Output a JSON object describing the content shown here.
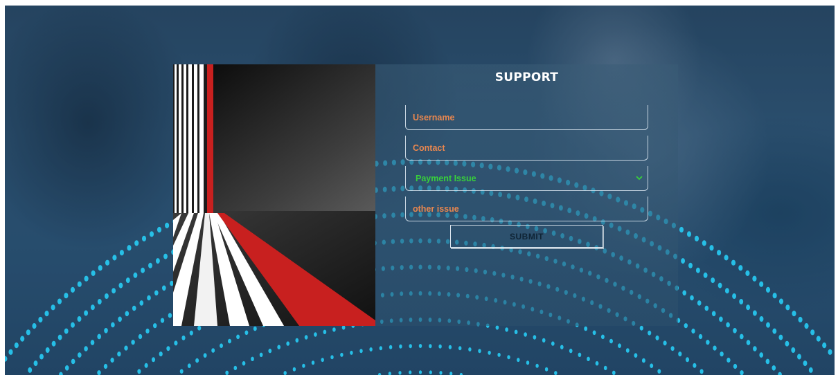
{
  "form": {
    "title": "SUPPORT",
    "username_placeholder": "Username",
    "contact_placeholder": "Contact",
    "issue_select_value": "Payment Issue",
    "other_issue_placeholder": "other issue",
    "submit_label": "SUBMIT"
  },
  "colors": {
    "placeholder": "#e9874f",
    "select_text": "#37d13a",
    "title": "#ffffff",
    "dots": "#27c6ee"
  }
}
